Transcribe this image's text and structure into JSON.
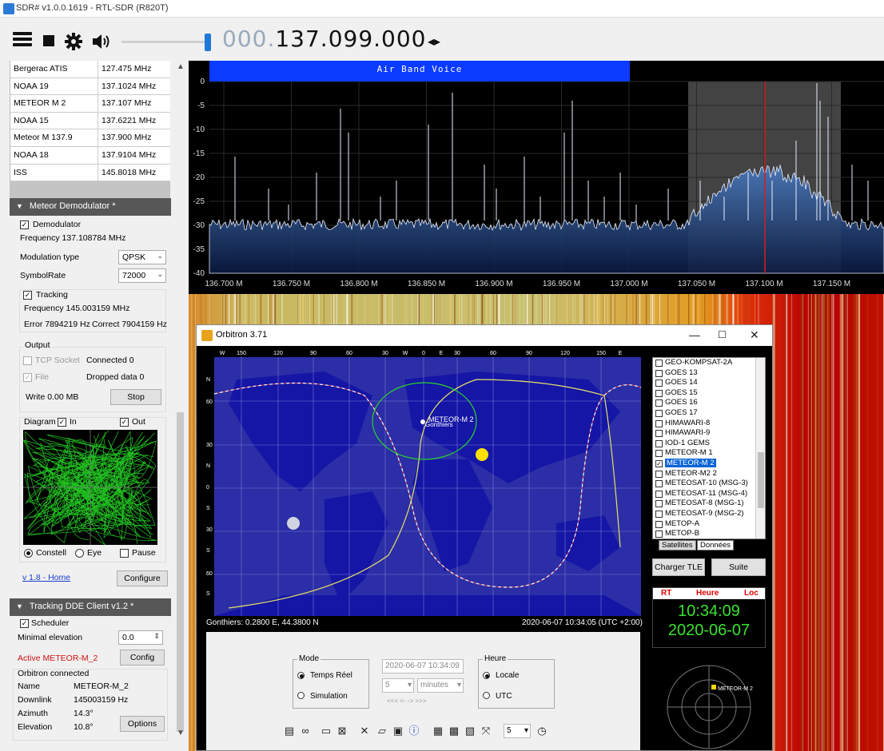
{
  "window_title": "SDR# v1.0.0.1619 - RTL-SDR (R820T)",
  "toolbar": {
    "frequency_dim": "000.",
    "frequency_main": "137.099.000",
    "freq_arrows": "◂▸"
  },
  "freq_table": [
    {
      "name": "Bergerac ATIS",
      "freq": "127.475 MHz"
    },
    {
      "name": "NOAA 19",
      "freq": "137.1024 MHz"
    },
    {
      "name": "METEOR M 2",
      "freq": "137.107 MHz"
    },
    {
      "name": "NOAA 15",
      "freq": "137.6221 MHz"
    },
    {
      "name": "Meteor M 137.9",
      "freq": "137.900 MHz"
    },
    {
      "name": "NOAA 18",
      "freq": "137.9104 MHz"
    },
    {
      "name": "ISS",
      "freq": "145.8018 MHz"
    }
  ],
  "meteor": {
    "header": "Meteor Demodulator *",
    "demod_label": "Demodulator",
    "frequency": "Frequency 137.108784 MHz",
    "mod_type_label": "Modulation type",
    "mod_type_value": "QPSK",
    "symbolrate_label": "SymbolRate",
    "symbolrate_value": "72000",
    "tracking_label": "Tracking",
    "tracking_freq": "Frequency 145.003159 MHz",
    "tracking_error": "Error 7894219 Hz",
    "tracking_correct": "Correct 7904159 Hz",
    "output_label": "Output",
    "tcp_label": "TCP Socket",
    "connected": "Connected 0",
    "file_label": "File",
    "dropped": "Dropped data 0",
    "write": "Write 0.00 MB",
    "stop_button": "Stop",
    "diagram_label": "Diagram",
    "in_label": "In",
    "out_label": "Out",
    "constell_label": "Constell",
    "eye_label": "Eye",
    "pause_label": "Pause",
    "home_link": "v 1.8 - Home",
    "configure_button": "Configure"
  },
  "tracking": {
    "header": "Tracking DDE Client v1.2 *",
    "scheduler_label": "Scheduler",
    "min_elev_label": "Minimal elevation",
    "min_elev_value": "0.0",
    "active_label": "Active METEOR-M_2",
    "config_button": "Config",
    "orbitron_connected": "Orbitron connected",
    "name_label": "Name",
    "name_value": "METEOR-M_2",
    "downlink_label": "Downlink",
    "downlink_value": "145003159 Hz",
    "azimuth_label": "Azimuth",
    "azimuth_value": "14.3°",
    "elevation_label": "Elevation",
    "elevation_value": "10.8°",
    "options_button": "Options"
  },
  "spectrum": {
    "band_label": "Air Band Voice",
    "y_ticks": [
      "0",
      "-5",
      "-10",
      "-15",
      "-20",
      "-25",
      "-30",
      "-35",
      "-40"
    ],
    "x_ticks": [
      "136.700 M",
      "136.750 M",
      "136.800 M",
      "136.850 M",
      "136.900 M",
      "136.950 M",
      "137.000 M",
      "137.050 M",
      "137.100 M",
      "137.150 M"
    ]
  },
  "orbitron": {
    "title": "Orbitron 3.71",
    "lon_labels": [
      "W",
      "150",
      "120",
      "90",
      "60",
      "30",
      "W",
      "0",
      "E",
      "30",
      "60",
      "90",
      "120",
      "150",
      "E"
    ],
    "lat_labels": [
      "N",
      "60",
      "30",
      "N",
      "0",
      "S",
      "30",
      "S",
      "60",
      "S"
    ],
    "sat_name": "METEOR-M 2",
    "observer": "Gonthiers",
    "status_left": "Gonthiers: 0.2800 E, 44.3800 N",
    "status_right": "2020-06-07 10:34:05 (UTC +2:00)",
    "satellites": [
      {
        "name": "GEO-KOMPSAT-2A",
        "checked": false,
        "selected": false
      },
      {
        "name": "GOES 13",
        "checked": false,
        "selected": false
      },
      {
        "name": "GOES 14",
        "checked": false,
        "selected": false
      },
      {
        "name": "GOES 15",
        "checked": false,
        "selected": false
      },
      {
        "name": "GOES 16",
        "checked": false,
        "selected": false
      },
      {
        "name": "GOES 17",
        "checked": false,
        "selected": false
      },
      {
        "name": "HIMAWARI-8",
        "checked": false,
        "selected": false
      },
      {
        "name": "HIMAWARI-9",
        "checked": false,
        "selected": false
      },
      {
        "name": "IOD-1 GEMS",
        "checked": false,
        "selected": false
      },
      {
        "name": "METEOR-M 1",
        "checked": false,
        "selected": false
      },
      {
        "name": "METEOR-M 2",
        "checked": true,
        "selected": true
      },
      {
        "name": "METEOR-M2 2",
        "checked": false,
        "selected": false
      },
      {
        "name": "METEOSAT-10 (MSG-3)",
        "checked": false,
        "selected": false
      },
      {
        "name": "METEOSAT-11 (MSG-4)",
        "checked": false,
        "selected": false
      },
      {
        "name": "METEOSAT-8 (MSG-1)",
        "checked": false,
        "selected": false
      },
      {
        "name": "METEOSAT-9 (MSG-2)",
        "checked": false,
        "selected": false
      },
      {
        "name": "METOP-A",
        "checked": false,
        "selected": false
      },
      {
        "name": "METOP-B",
        "checked": false,
        "selected": false
      }
    ],
    "tab_satellites": "Satellites",
    "tab_donnees": "Données",
    "charger_tle": "Charger TLE",
    "suite": "Suite",
    "clock_rt": "RT",
    "clock_heure": "Heure",
    "clock_loc": "Loc",
    "clock_time": "10:34:09",
    "clock_date": "2020-06-07",
    "mode_legend": "Mode",
    "temps_reel": "Temps Réel",
    "simulation": "Simulation",
    "sim_datetime": "2020-06-07 10:34:09",
    "step_value": "5",
    "step_unit": "minutes",
    "nav_arrows": "<<<    <-    ->    >>>",
    "heure_legend": "Heure",
    "locale": "Locale",
    "utc": "UTC",
    "speed_value": "5",
    "polar_sat": "METEOR-M 2"
  }
}
